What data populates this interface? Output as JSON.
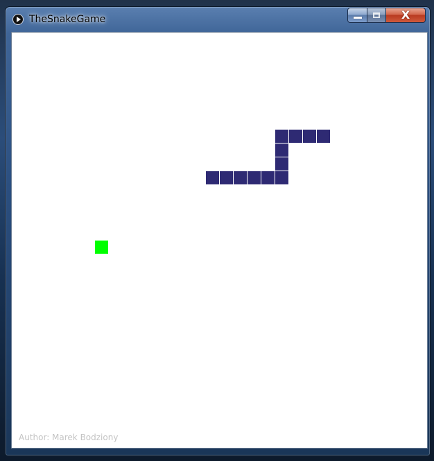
{
  "window": {
    "title": "TheSnakeGame",
    "controls": {
      "minimize_icon": "minimize-icon",
      "maximize_icon": "maximize-icon",
      "close_icon": "close-icon",
      "close_glyph": "X"
    }
  },
  "game": {
    "grid_columns": 30,
    "grid_rows": 30,
    "snake_color": "#2e2a73",
    "food_color": "#00ff00",
    "snake": [
      [
        19,
        7
      ],
      [
        20,
        7
      ],
      [
        21,
        7
      ],
      [
        22,
        7
      ],
      [
        19,
        8
      ],
      [
        19,
        9
      ],
      [
        14,
        10
      ],
      [
        15,
        10
      ],
      [
        16,
        10
      ],
      [
        17,
        10
      ],
      [
        18,
        10
      ],
      [
        19,
        10
      ]
    ],
    "food": [
      6,
      15
    ],
    "author": "Author: Marek Bodziony"
  }
}
